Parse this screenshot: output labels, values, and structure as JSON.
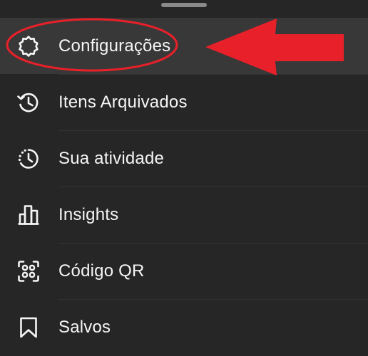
{
  "menu": {
    "items": [
      {
        "label": "Configurações",
        "icon": "gear-icon",
        "active": true
      },
      {
        "label": "Itens Arquivados",
        "icon": "archive-history-icon",
        "active": false
      },
      {
        "label": "Sua atividade",
        "icon": "activity-clock-icon",
        "active": false
      },
      {
        "label": "Insights",
        "icon": "bar-chart-icon",
        "active": false
      },
      {
        "label": "Código QR",
        "icon": "qr-code-icon",
        "active": false
      },
      {
        "label": "Salvos",
        "icon": "bookmark-icon",
        "active": false
      }
    ]
  },
  "annotation": {
    "highlight_color": "#e8202a",
    "arrow_color": "#e8202a"
  },
  "colors": {
    "background": "#262626",
    "active_row": "#383838",
    "text": "#f5f5f5"
  }
}
